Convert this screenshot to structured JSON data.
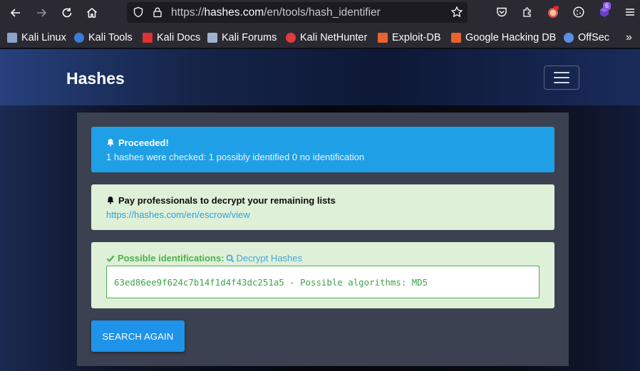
{
  "browser": {
    "url_prefix": "https://",
    "url_host": "hashes.com",
    "url_path": "/en/tools/hash_identifier",
    "extension_badge": "6"
  },
  "bookmarks": [
    {
      "label": "Kali Linux",
      "color": "#8aa4c8"
    },
    {
      "label": "Kali Tools",
      "color": "#3c7cd8"
    },
    {
      "label": "Kali Docs",
      "color": "#e0312e"
    },
    {
      "label": "Kali Forums",
      "color": "#9fb3cc"
    },
    {
      "label": "Kali NetHunter",
      "color": "#e53a3a"
    },
    {
      "label": "Exploit-DB",
      "color": "#e8642c"
    },
    {
      "label": "Google Hacking DB",
      "color": "#e8642c"
    },
    {
      "label": "OffSec",
      "color": "#5b8fe6"
    }
  ],
  "site": {
    "brand": "Hashes"
  },
  "alerts": {
    "info_title": "Proceeded!",
    "info_body": "1 hashes were checked: 1 possibly identified 0 no identification",
    "pro_title": "Pay professionals to decrypt your remaining lists",
    "pro_link": "https://hashes.com/en/escrow/view"
  },
  "result": {
    "heading": "Possible identifications:",
    "decrypt_link": "Decrypt Hashes",
    "line": "63ed86ee9f624c7b14f1d4f43dc251a5 - Possible algorithms: MD5"
  },
  "actions": {
    "search_again": "SEARCH AGAIN"
  },
  "colors": {
    "info": "#1fa0e6",
    "success_bg": "#dff0d8",
    "success_text": "#4db04d",
    "primary_button": "#1f92ea"
  }
}
